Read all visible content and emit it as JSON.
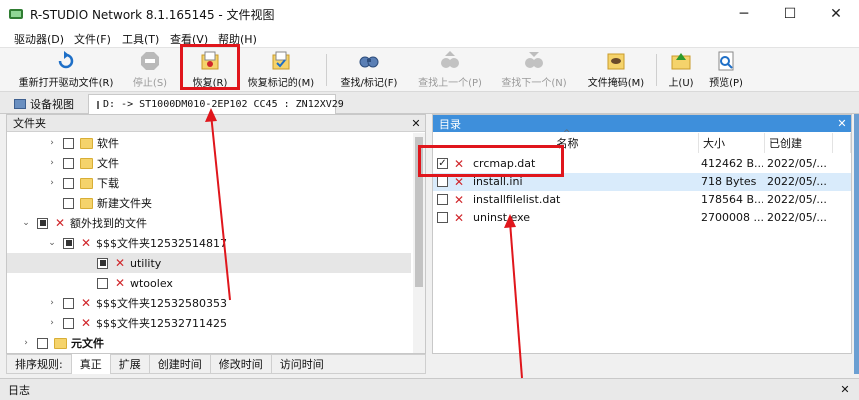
{
  "window": {
    "title": "R-STUDIO Network 8.1.165145 - 文件视图",
    "minimize": "─",
    "maximize": "☐",
    "close": "✕"
  },
  "menu": [
    "驱动器(D)",
    "文件(F)",
    "工具(T)",
    "查看(V)",
    "帮助(H)"
  ],
  "toolbar": [
    {
      "label": "重新打开驱动文件(R)",
      "icon": "reload-icon",
      "disabled": false
    },
    {
      "label": "停止(S)",
      "icon": "stop-icon",
      "disabled": true
    },
    {
      "label": "恢复(R)",
      "icon": "recover-icon",
      "disabled": false
    },
    {
      "label": "恢复标记的(M)",
      "icon": "recover-marked-icon",
      "disabled": false
    },
    {
      "label": "查找/标记(F)",
      "icon": "find-mark-icon",
      "disabled": false
    },
    {
      "label": "查找上一个(P)",
      "icon": "find-prev-icon",
      "disabled": true
    },
    {
      "label": "查找下一个(N)",
      "icon": "find-next-icon",
      "disabled": true
    },
    {
      "label": "文件掩码(M)",
      "icon": "file-mask-icon",
      "disabled": false
    },
    {
      "label": "上(U)",
      "icon": "up-folder-icon",
      "disabled": false
    },
    {
      "label": "预览(P)",
      "icon": "preview-icon",
      "disabled": false
    }
  ],
  "tabs": {
    "device_view": "设备视图",
    "drive": "D: -> ST1000DM010-2EP102 CC45 : ZN12XV29"
  },
  "left_pane": {
    "title": "文件夹",
    "close": "✕",
    "tree": [
      {
        "label": "软件",
        "level": 2,
        "chevron": "›",
        "check": "none",
        "icon": "folder",
        "bold": false
      },
      {
        "label": "文件",
        "level": 2,
        "chevron": "›",
        "check": "none",
        "icon": "folder",
        "bold": false
      },
      {
        "label": "下载",
        "level": 2,
        "chevron": "›",
        "check": "none",
        "icon": "folder",
        "bold": false
      },
      {
        "label": "新建文件夹",
        "level": 2,
        "chevron": "",
        "check": "none",
        "icon": "folder",
        "bold": false
      },
      {
        "label": "额外找到的文件",
        "level": 1,
        "chevron": "⌄",
        "check": "partial",
        "icon": "x",
        "bold": false
      },
      {
        "label": "$$$文件夹12532514817",
        "level": 2,
        "chevron": "⌄",
        "check": "partial",
        "icon": "x",
        "bold": false
      },
      {
        "label": "utility",
        "level": 3,
        "chevron": "",
        "check": "partial",
        "icon": "x",
        "bold": false,
        "selected": true
      },
      {
        "label": "wtoolex",
        "level": 3,
        "chevron": "",
        "check": "none",
        "icon": "x",
        "bold": false
      },
      {
        "label": "$$$文件夹12532580353",
        "level": 2,
        "chevron": "›",
        "check": "none",
        "icon": "x",
        "bold": false
      },
      {
        "label": "$$$文件夹12532711425",
        "level": 2,
        "chevron": "›",
        "check": "none",
        "icon": "x",
        "bold": false
      },
      {
        "label": "元文件",
        "level": 1,
        "chevron": "›",
        "check": "none",
        "icon": "folder",
        "bold": true
      }
    ]
  },
  "right_pane": {
    "title": "目录",
    "close": "✕",
    "columns": [
      "名称",
      "大小",
      "已创建"
    ],
    "sort_glyph": "^",
    "files": [
      {
        "name": "crcmap.dat",
        "size": "412462 B...",
        "created": "2022/05/...",
        "checked": true
      },
      {
        "name": "install.ini",
        "size": "718 Bytes",
        "created": "2022/05/...",
        "checked": false,
        "selected": true
      },
      {
        "name": "installfilelist.dat",
        "size": "178564 B...",
        "created": "2022/05/...",
        "checked": false
      },
      {
        "name": "uninst.exe",
        "size": "2700008 ...",
        "created": "2022/05/...",
        "checked": false
      }
    ]
  },
  "sortbar": {
    "label": "排序规则:",
    "options": [
      "真正",
      "扩展",
      "创建时间",
      "修改时间",
      "访问时间"
    ],
    "active": 0
  },
  "log": {
    "title": "日志",
    "close": "✕"
  },
  "colors": {
    "accent": "#3e8fdb",
    "highlight": "#e0161c",
    "folder": "#f5d36b",
    "deleted": "#d0262b"
  }
}
